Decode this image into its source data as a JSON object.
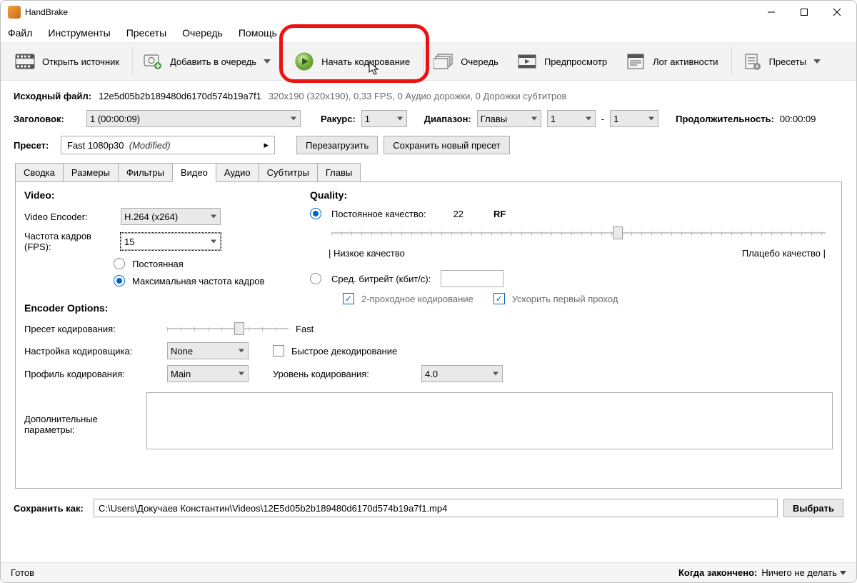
{
  "app": {
    "title": "HandBrake"
  },
  "menu": {
    "file": "Файл",
    "tools": "Инструменты",
    "presets": "Пресеты",
    "queue": "Очередь",
    "help": "Помощь"
  },
  "toolbar": {
    "open": "Открыть источник",
    "addqueue": "Добавить в очередь",
    "start": "Начать кодирование",
    "queue": "Очередь",
    "preview": "Предпросмотр",
    "log": "Лог активности",
    "presets": "Пресеты"
  },
  "source": {
    "label": "Исходный файл:",
    "name": "12e5d05b2b189480d6170d574b19a7f1",
    "info": "320x190 (320x190), 0,33 FPS, 0 Аудио дорожки, 0 Дорожки субтитров"
  },
  "titleRow": {
    "titleLabel": "Заголовок:",
    "titleValue": "1  (00:00:09)",
    "angleLabel": "Ракурс:",
    "angleValue": "1",
    "rangeLabel": "Диапазон:",
    "rangeType": "Главы",
    "rangeFrom": "1",
    "dash": "-",
    "rangeTo": "1",
    "durationLabel": "Продолжительность:",
    "durationValue": "00:00:09"
  },
  "presetRow": {
    "label": "Пресет:",
    "name": "Fast 1080p30",
    "modified": "(Modified)",
    "reload": "Перезагрузить",
    "saveNew": "Сохранить новый пресет"
  },
  "tabs": {
    "summary": "Сводка",
    "dimensions": "Размеры",
    "filters": "Фильтры",
    "video": "Видео",
    "audio": "Аудио",
    "subtitles": "Субтитры",
    "chapters": "Главы"
  },
  "video": {
    "videoHeader": "Video:",
    "encoderLabel": "Video Encoder:",
    "encoderValue": "H.264 (x264)",
    "fpsLabel": "Частота кадров (FPS):",
    "fpsValue": "15",
    "constantFps": "Постоянная",
    "peakFps": "Максимальная частота кадров",
    "qualityHeader": "Quality:",
    "constQuality": "Постоянное качество:",
    "rfValue": "22",
    "rfUnit": "RF",
    "lowQuality": "| Низкое качество",
    "placeboQuality": "Плацебо качество |",
    "avgBitrate": "Сред. битрейт (кбит/с):",
    "twoPass": "2-проходное кодирование",
    "turbo": "Ускорить первый проход",
    "encOptionsHeader": "Encoder Options:",
    "encPresetLabel": "Пресет кодирования:",
    "encPresetValue": "Fast",
    "tuneLabel": "Настройка кодировщика:",
    "tuneValue": "None",
    "fastDecode": "Быстрое декодирование",
    "profileLabel": "Профиль кодирования:",
    "profileValue": "Main",
    "levelLabel": "Уровень кодирования:",
    "levelValue": "4.0",
    "extraLabel": "Дополнительные параметры:"
  },
  "save": {
    "label": "Сохранить как:",
    "path": "C:\\Users\\Докучаев Константин\\Videos\\12E5d05b2b189480d6170d574b19a7f1.mp4",
    "browse": "Выбрать"
  },
  "status": {
    "ready": "Готов",
    "whenDoneLabel": "Когда закончено:",
    "whenDoneValue": "Ничего не делать"
  }
}
